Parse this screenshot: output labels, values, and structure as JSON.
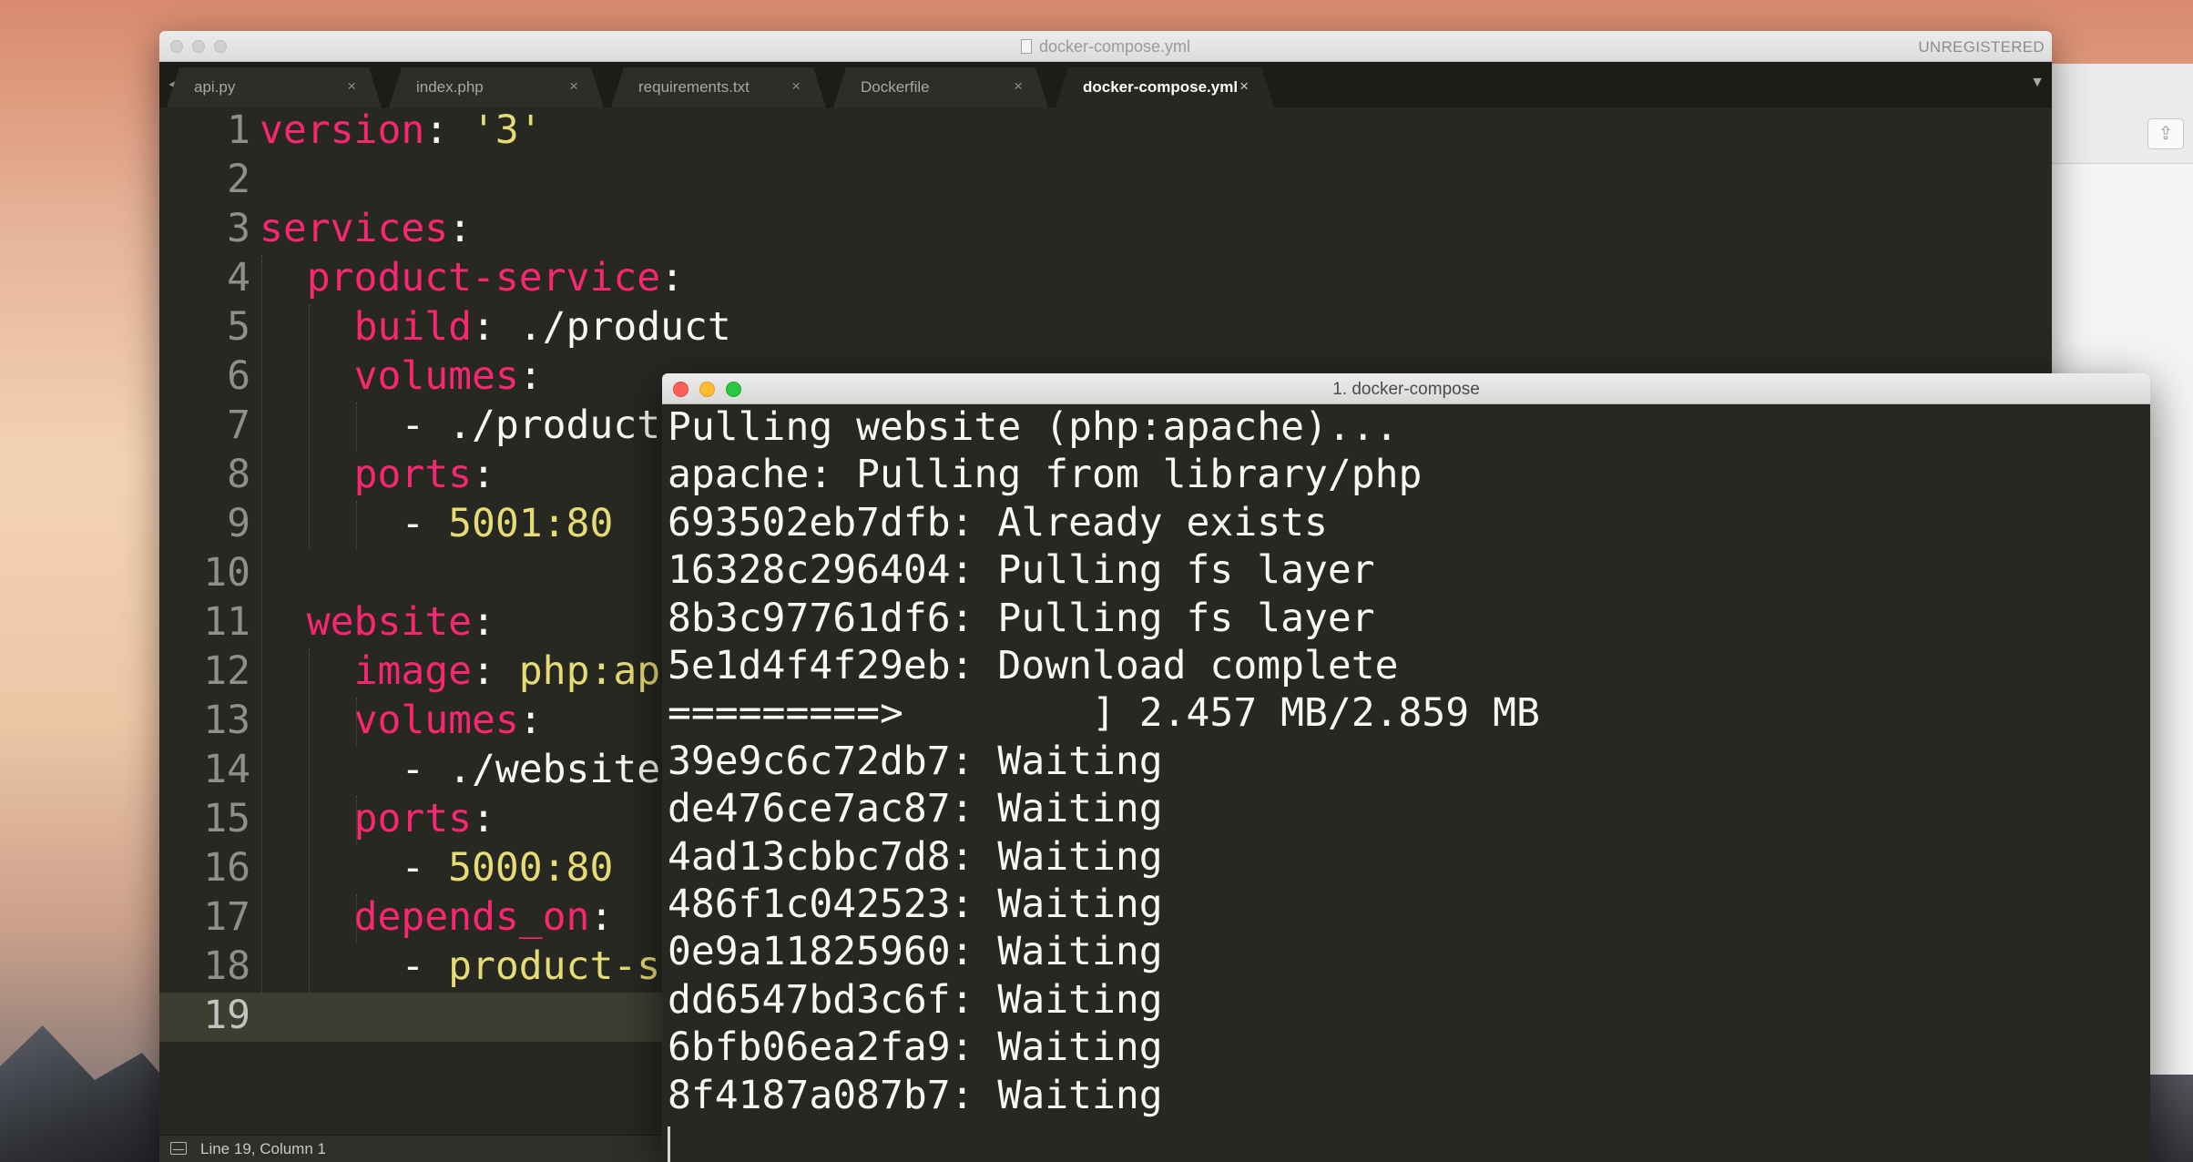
{
  "editor": {
    "title": "docker-compose.yml",
    "license": "UNREGISTERED",
    "tabs": [
      {
        "label": "api.py",
        "active": false
      },
      {
        "label": "index.php",
        "active": false
      },
      {
        "label": "requirements.txt",
        "active": false
      },
      {
        "label": "Dockerfile",
        "active": false
      },
      {
        "label": "docker-compose.yml",
        "active": true
      }
    ],
    "tab_close_glyph": "×",
    "nav_glyph": "◀ ▶",
    "overflow_glyph": "▼",
    "lines": [
      {
        "num": "1",
        "segments": [
          {
            "t": "version",
            "c": "k"
          },
          {
            "t": ": ",
            "c": "p"
          },
          {
            "t": "'3'",
            "c": "s"
          }
        ]
      },
      {
        "num": "2",
        "segments": []
      },
      {
        "num": "3",
        "segments": [
          {
            "t": "services",
            "c": "k"
          },
          {
            "t": ":",
            "c": "p"
          }
        ]
      },
      {
        "num": "4",
        "segments": [
          {
            "t": "  ",
            "c": "p"
          },
          {
            "t": "product-service",
            "c": "k"
          },
          {
            "t": ":",
            "c": "p"
          }
        ]
      },
      {
        "num": "5",
        "segments": [
          {
            "t": "    ",
            "c": "p"
          },
          {
            "t": "build",
            "c": "k"
          },
          {
            "t": ": ./product",
            "c": "p"
          }
        ]
      },
      {
        "num": "6",
        "segments": [
          {
            "t": "    ",
            "c": "p"
          },
          {
            "t": "volumes",
            "c": "k"
          },
          {
            "t": ":",
            "c": "p"
          }
        ]
      },
      {
        "num": "7",
        "segments": [
          {
            "t": "      - ./product",
            "c": "p"
          }
        ]
      },
      {
        "num": "8",
        "segments": [
          {
            "t": "    ",
            "c": "p"
          },
          {
            "t": "ports",
            "c": "k"
          },
          {
            "t": ":",
            "c": "p"
          }
        ]
      },
      {
        "num": "9",
        "segments": [
          {
            "t": "      - ",
            "c": "p"
          },
          {
            "t": "5001:80",
            "c": "n"
          }
        ]
      },
      {
        "num": "10",
        "segments": []
      },
      {
        "num": "11",
        "segments": [
          {
            "t": "  ",
            "c": "p"
          },
          {
            "t": "website",
            "c": "k"
          },
          {
            "t": ":",
            "c": "p"
          }
        ]
      },
      {
        "num": "12",
        "segments": [
          {
            "t": "    ",
            "c": "p"
          },
          {
            "t": "image",
            "c": "k"
          },
          {
            "t": ": ",
            "c": "p"
          },
          {
            "t": "php:ap",
            "c": "n"
          }
        ]
      },
      {
        "num": "13",
        "segments": [
          {
            "t": "    ",
            "c": "p"
          },
          {
            "t": "volumes",
            "c": "k"
          },
          {
            "t": ":",
            "c": "p"
          }
        ]
      },
      {
        "num": "14",
        "segments": [
          {
            "t": "      - ./website",
            "c": "p"
          }
        ]
      },
      {
        "num": "15",
        "segments": [
          {
            "t": "    ",
            "c": "p"
          },
          {
            "t": "ports",
            "c": "k"
          },
          {
            "t": ":",
            "c": "p"
          }
        ]
      },
      {
        "num": "16",
        "segments": [
          {
            "t": "      - ",
            "c": "p"
          },
          {
            "t": "5000:80",
            "c": "n"
          }
        ]
      },
      {
        "num": "17",
        "segments": [
          {
            "t": "    ",
            "c": "p"
          },
          {
            "t": "depends_on",
            "c": "k"
          },
          {
            "t": ":",
            "c": "p"
          }
        ]
      },
      {
        "num": "18",
        "segments": [
          {
            "t": "      - ",
            "c": "p"
          },
          {
            "t": "product-s",
            "c": "n"
          }
        ]
      },
      {
        "num": "19",
        "segments": []
      }
    ],
    "current_line": "19",
    "status": "Line 19, Column 1"
  },
  "terminal": {
    "title": "1. docker-compose",
    "lines": [
      "Pulling website (php:apache)...",
      "apache: Pulling from library/php",
      "693502eb7dfb: Already exists",
      "16328c296404: Pulling fs layer",
      "8b3c97761df6: Pulling fs layer",
      "5e1d4f4f29eb: Download complete",
      "=========>        ] 2.457 MB/2.859 MB",
      "39e9c6c72db7: Waiting",
      "de476ce7ac87: Waiting",
      "4ad13cbbc7d8: Waiting",
      "486f1c042523: Waiting",
      "0e9a11825960: Waiting",
      "dd6547bd3c6f: Waiting",
      "6bfb06ea2fa9: Waiting",
      "8f4187a087b7: Waiting"
    ]
  },
  "colors": {
    "editor_bg": "#272822",
    "keyword": "#f92672",
    "string": "#e6db74",
    "text": "#f8f8f2"
  }
}
